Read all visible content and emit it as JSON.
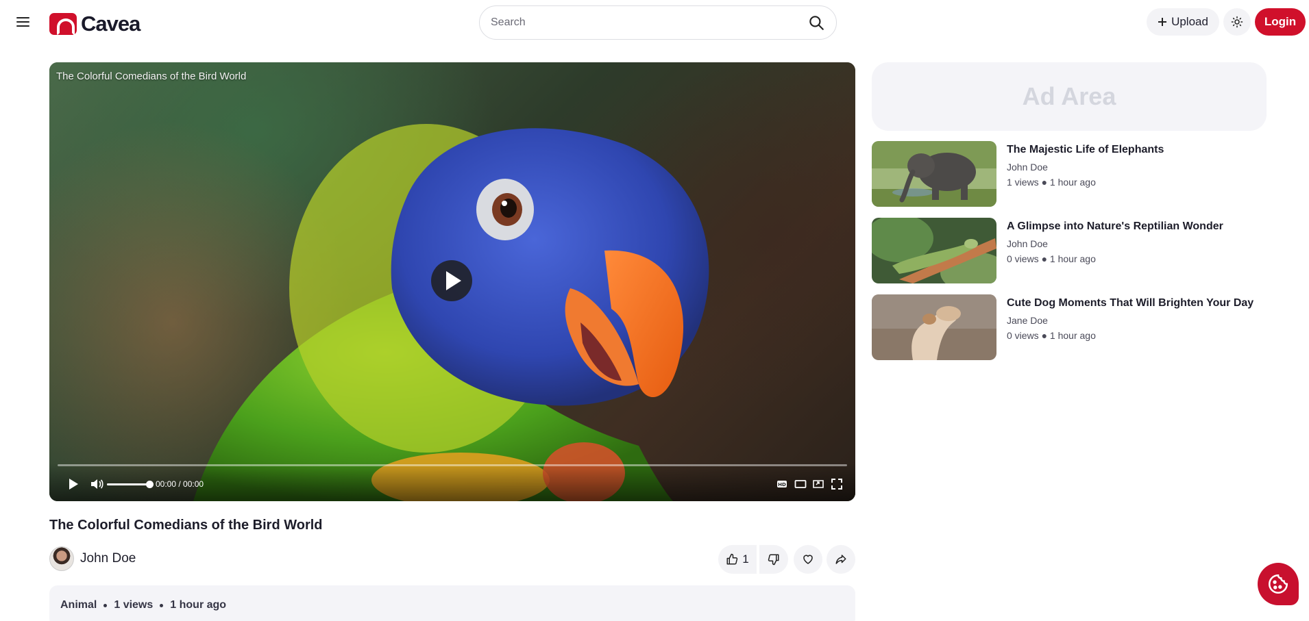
{
  "header": {
    "logo_text": "Cavea",
    "search_placeholder": "Search",
    "upload_label": "Upload",
    "login_label": "Login",
    "accent_color": "#d0102b"
  },
  "player": {
    "overlay_title": "The Colorful Comedians of the Bird World",
    "time": "00:00 / 00:00",
    "progress": 0,
    "volume": 1.0
  },
  "video": {
    "title": "The Colorful Comedians of the Bird World",
    "channel_name": "John Doe",
    "likes": "1",
    "category": "Animal",
    "views": "1 views",
    "uploaded": "1 hour ago"
  },
  "sidebar": {
    "ad_label": "Ad Area",
    "recommendations": [
      {
        "title": "The Majestic Life of Elephants",
        "channel": "John Doe",
        "meta": "1 views ● 1 hour ago"
      },
      {
        "title": "A Glimpse into Nature's Reptilian Wonder",
        "channel": "John Doe",
        "meta": "0 views ● 1 hour ago"
      },
      {
        "title": "Cute Dog Moments That Will Brighten Your Day",
        "channel": "Jane Doe",
        "meta": "0 views ● 1 hour ago"
      }
    ]
  },
  "icons": {
    "menu": "menu-icon",
    "search": "search-icon",
    "upload": "plus-icon",
    "theme": "sun-icon",
    "like": "thumbs-up-icon",
    "dislike": "thumbs-down-icon",
    "favorite": "heart-icon",
    "share": "share-icon",
    "cookie": "cookie-icon"
  }
}
